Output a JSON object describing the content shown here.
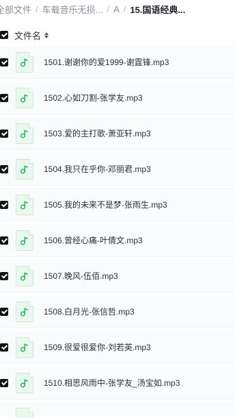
{
  "breadcrumb": {
    "items": [
      "全部文件",
      "车载音乐无损...",
      "A"
    ],
    "separator": "/",
    "current": "15.国语经典..."
  },
  "header": {
    "label": "文件名"
  },
  "files": [
    {
      "name": "1501.谢谢你的爱1999-谢霆锋.mp3"
    },
    {
      "name": "1502.心如刀割-张学友.mp3"
    },
    {
      "name": "1503.爱的主打歌-萧亚轩.mp3"
    },
    {
      "name": "1504.我只在乎你-邓丽君.mp3"
    },
    {
      "name": "1505.我的未来不是梦-张雨生.mp3"
    },
    {
      "name": "1506.曾经心痛-叶倩文.mp3"
    },
    {
      "name": "1507.晚风-伍佰.mp3"
    },
    {
      "name": "1508.白月光-张信哲.mp3"
    },
    {
      "name": "1509.很爱很爱你-刘若英.mp3"
    },
    {
      "name": "1510.相思风雨中-张学友_汤宝如.mp3"
    }
  ],
  "icons": {
    "file": "music-file-icon",
    "sort": "sort-icon",
    "checkbox": "checkbox-checked"
  },
  "colors": {
    "icon_green": "#2cb561",
    "checkbox": "#111111",
    "muted_text": "#8a9099"
  }
}
